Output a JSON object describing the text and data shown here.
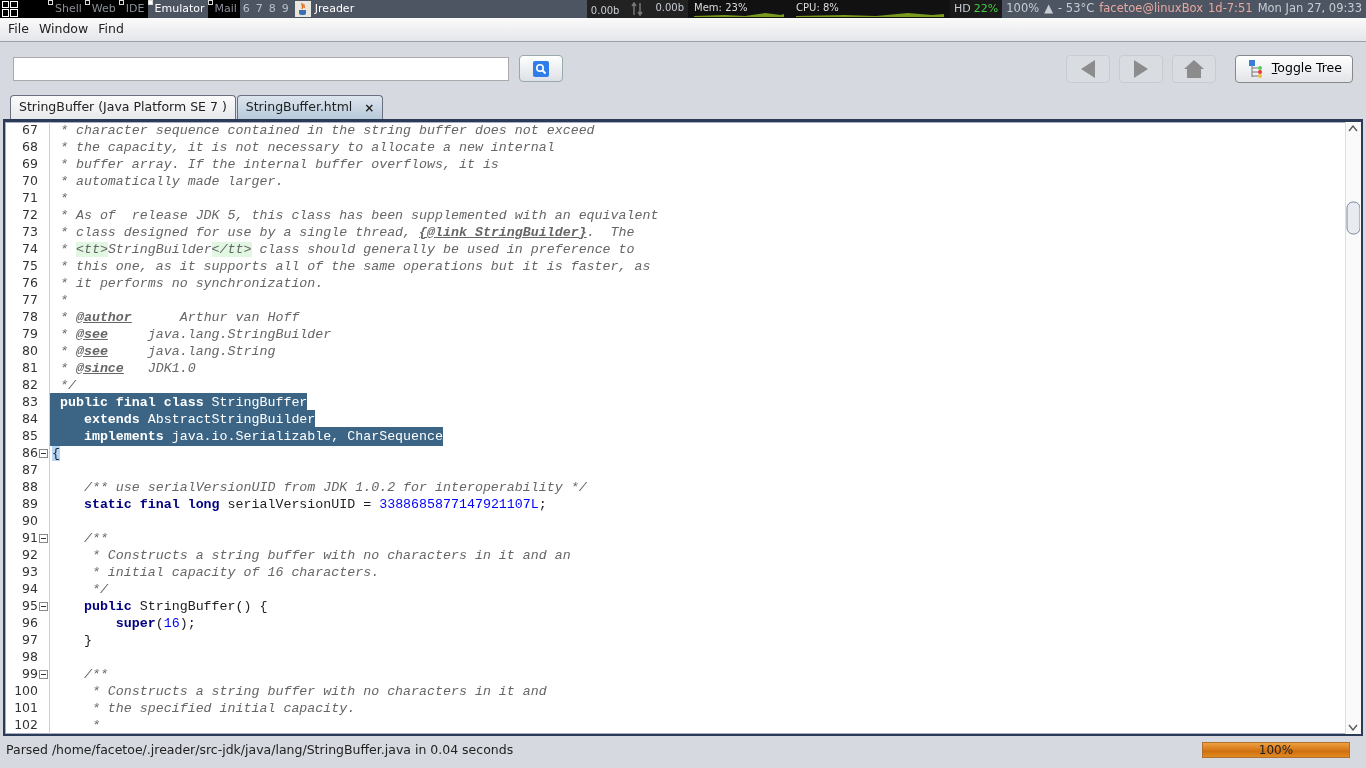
{
  "taskbar": {
    "workspaces": [
      {
        "label": "Shell",
        "selected": false,
        "has_windows": true
      },
      {
        "label": "Web",
        "selected": false,
        "has_windows": true
      },
      {
        "label": "IDE",
        "selected": false,
        "has_windows": true
      },
      {
        "label": "Emulator",
        "selected": true,
        "has_windows": true
      },
      {
        "label": "Mail",
        "selected": false,
        "has_windows": true
      },
      {
        "label": "6",
        "selected": false,
        "has_windows": false
      },
      {
        "label": "7",
        "selected": false,
        "has_windows": false
      },
      {
        "label": "8",
        "selected": false,
        "has_windows": false
      },
      {
        "label": "9",
        "selected": false,
        "has_windows": false
      }
    ],
    "active_window": "Jreader",
    "net_down": "0.00b",
    "net_up": "0.00b",
    "mem": "Mem: 23%",
    "cpu": "CPU: 8%",
    "hd_label": "HD",
    "hd_value": "22%",
    "volume": "100%",
    "volume_arrow": "▲",
    "temp": "- 53°C",
    "user": "facetoe@linuxBox",
    "uptime": "1d-7:51",
    "clock": "Mon Jan 27, 09:33"
  },
  "menu": [
    "File",
    "Window",
    "Find"
  ],
  "toggle_tree": {
    "label": "Toggle Tree"
  },
  "tabs": [
    {
      "label": "StringBuffer (Java Platform SE 7 )",
      "selected": false,
      "closable": false
    },
    {
      "label": "StringBuffer.html",
      "selected": true,
      "closable": true,
      "close": "×"
    }
  ],
  "code": [
    {
      "n": "67",
      "fold": false,
      "selected": false,
      "segments": [
        {
          "kind": "comment",
          "text": " * character sequence contained in the string buffer does not exceed"
        }
      ]
    },
    {
      "n": "68",
      "fold": false,
      "selected": false,
      "segments": [
        {
          "kind": "comment",
          "text": " * the capacity, it is not necessary to allocate a new internal"
        }
      ]
    },
    {
      "n": "69",
      "fold": false,
      "selected": false,
      "segments": [
        {
          "kind": "comment",
          "text": " * buffer array. If the internal buffer overflows, it is"
        }
      ]
    },
    {
      "n": "70",
      "fold": false,
      "selected": false,
      "segments": [
        {
          "kind": "comment",
          "text": " * automatically made larger."
        }
      ]
    },
    {
      "n": "71",
      "fold": false,
      "selected": false,
      "segments": [
        {
          "kind": "comment",
          "text": " *"
        }
      ]
    },
    {
      "n": "72",
      "fold": false,
      "selected": false,
      "segments": [
        {
          "kind": "comment",
          "text": " * As of  release JDK 5, this class has been supplemented with an equivalent"
        }
      ]
    },
    {
      "n": "73",
      "fold": false,
      "selected": false,
      "segments": [
        {
          "kind": "comment",
          "text": " * class designed for use by a single thread, "
        },
        {
          "kind": "doctag",
          "text": "{@link StringBuilder}"
        },
        {
          "kind": "comment",
          "text": ".  The"
        }
      ]
    },
    {
      "n": "74",
      "fold": false,
      "selected": false,
      "segments": [
        {
          "kind": "comment",
          "text": " * "
        },
        {
          "kind": "tag",
          "text": "<tt>"
        },
        {
          "kind": "comment",
          "text": "StringBuilder"
        },
        {
          "kind": "tag",
          "text": "</tt>"
        },
        {
          "kind": "comment",
          "text": " class should generally be used in preference to"
        }
      ]
    },
    {
      "n": "75",
      "fold": false,
      "selected": false,
      "segments": [
        {
          "kind": "comment",
          "text": " * this one, as it supports all of the same operations but it is faster, as"
        }
      ]
    },
    {
      "n": "76",
      "fold": false,
      "selected": false,
      "segments": [
        {
          "kind": "comment",
          "text": " * it performs no synchronization."
        }
      ]
    },
    {
      "n": "77",
      "fold": false,
      "selected": false,
      "segments": [
        {
          "kind": "comment",
          "text": " *"
        }
      ]
    },
    {
      "n": "78",
      "fold": false,
      "selected": false,
      "segments": [
        {
          "kind": "comment",
          "text": " * "
        },
        {
          "kind": "doctag",
          "text": "@author"
        },
        {
          "kind": "comment",
          "text": "      Arthur van Hoff"
        }
      ]
    },
    {
      "n": "79",
      "fold": false,
      "selected": false,
      "segments": [
        {
          "kind": "comment",
          "text": " * "
        },
        {
          "kind": "doctag",
          "text": "@see"
        },
        {
          "kind": "comment",
          "text": "     java.lang.StringBuilder"
        }
      ]
    },
    {
      "n": "80",
      "fold": false,
      "selected": false,
      "segments": [
        {
          "kind": "comment",
          "text": " * "
        },
        {
          "kind": "doctag",
          "text": "@see"
        },
        {
          "kind": "comment",
          "text": "     java.lang.String"
        }
      ]
    },
    {
      "n": "81",
      "fold": false,
      "selected": false,
      "segments": [
        {
          "kind": "comment",
          "text": " * "
        },
        {
          "kind": "doctag",
          "text": "@since"
        },
        {
          "kind": "comment",
          "text": "   JDK1.0"
        }
      ]
    },
    {
      "n": "82",
      "fold": false,
      "selected": false,
      "segments": [
        {
          "kind": "comment",
          "text": " */"
        }
      ]
    },
    {
      "n": "83",
      "fold": false,
      "selected": true,
      "segments": [
        {
          "kind": "keyword",
          "text": " public final class"
        },
        {
          "kind": "plain",
          "text": " StringBuffer"
        }
      ]
    },
    {
      "n": "84",
      "fold": false,
      "selected": true,
      "segments": [
        {
          "kind": "keyword",
          "text": "    extends"
        },
        {
          "kind": "plain",
          "text": " AbstractStringBuilder"
        }
      ]
    },
    {
      "n": "85",
      "fold": false,
      "selected": true,
      "segments": [
        {
          "kind": "keyword",
          "text": "    implements"
        },
        {
          "kind": "plain",
          "text": " java.io.Serializable, CharSequence"
        }
      ]
    },
    {
      "n": "86",
      "fold": true,
      "selected": false,
      "segments": [
        {
          "kind": "bracket",
          "text": "{"
        }
      ]
    },
    {
      "n": "87",
      "fold": false,
      "selected": false
    },
    {
      "n": "88",
      "fold": false,
      "selected": false,
      "segments": [
        {
          "kind": "comment",
          "text": "    /** use serialVersionUID from JDK 1.0.2 for interoperability */"
        }
      ]
    },
    {
      "n": "89",
      "fold": false,
      "selected": false,
      "segments": [
        {
          "kind": "keyword",
          "text": "    static final long"
        },
        {
          "kind": "plain",
          "text": " serialVersionUID = "
        },
        {
          "kind": "number",
          "text": "3388685877147921107L"
        },
        {
          "kind": "plain",
          "text": ";"
        }
      ]
    },
    {
      "n": "90",
      "fold": false,
      "selected": false
    },
    {
      "n": "91",
      "fold": true,
      "selected": false,
      "segments": [
        {
          "kind": "comment",
          "text": "    /**"
        }
      ]
    },
    {
      "n": "92",
      "fold": false,
      "selected": false,
      "segments": [
        {
          "kind": "comment",
          "text": "     * Constructs a string buffer with no characters in it and an"
        }
      ]
    },
    {
      "n": "93",
      "fold": false,
      "selected": false,
      "segments": [
        {
          "kind": "comment",
          "text": "     * initial capacity of 16 characters."
        }
      ]
    },
    {
      "n": "94",
      "fold": false,
      "selected": false,
      "segments": [
        {
          "kind": "comment",
          "text": "     */"
        }
      ]
    },
    {
      "n": "95",
      "fold": true,
      "selected": false,
      "segments": [
        {
          "kind": "keyword",
          "text": "    public"
        },
        {
          "kind": "plain",
          "text": " StringBuffer() {"
        }
      ]
    },
    {
      "n": "96",
      "fold": false,
      "selected": false,
      "segments": [
        {
          "kind": "keyword",
          "text": "        super"
        },
        {
          "kind": "plain",
          "text": "("
        },
        {
          "kind": "number",
          "text": "16"
        },
        {
          "kind": "plain",
          "text": ");"
        }
      ]
    },
    {
      "n": "97",
      "fold": false,
      "selected": false,
      "segments": [
        {
          "kind": "plain",
          "text": "    }"
        }
      ]
    },
    {
      "n": "98",
      "fold": false,
      "selected": false
    },
    {
      "n": "99",
      "fold": true,
      "selected": false,
      "segments": [
        {
          "kind": "comment",
          "text": "    /**"
        }
      ]
    },
    {
      "n": "100",
      "fold": false,
      "selected": false,
      "segments": [
        {
          "kind": "comment",
          "text": "     * Constructs a string buffer with no characters in it and"
        }
      ]
    },
    {
      "n": "101",
      "fold": false,
      "selected": false,
      "segments": [
        {
          "kind": "comment",
          "text": "     * the specified initial capacity."
        }
      ]
    },
    {
      "n": "102",
      "fold": false,
      "selected": false,
      "segments": [
        {
          "kind": "comment",
          "text": "     *"
        }
      ]
    }
  ],
  "status_bar": {
    "message": "Parsed /home/facetoe/.jreader/src-jdk/java/lang/StringBuffer.java in 0.04 seconds",
    "progress": {
      "level": 1,
      "reading": "100%"
    }
  }
}
